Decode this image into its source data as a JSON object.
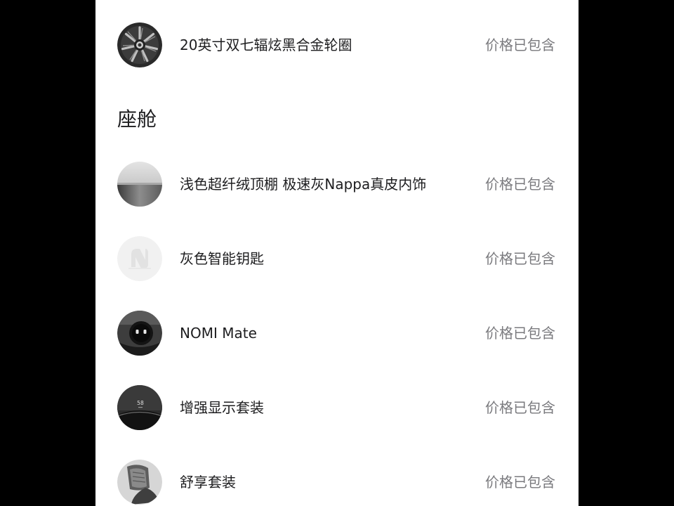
{
  "sections": [
    {
      "title": "",
      "items": [
        {
          "icon": "wheel-icon",
          "name": "20英寸双七辐炫黑合金轮圈",
          "price": "价格已包含"
        }
      ]
    },
    {
      "title": "座舱",
      "items": [
        {
          "icon": "interior-swatch-icon",
          "name": "浅色超纤绒顶棚 极速灰Nappa真皮内饰",
          "price": "价格已包含"
        },
        {
          "icon": "smart-key-icon",
          "name": "灰色智能钥匙",
          "price": "价格已包含"
        },
        {
          "icon": "nomi-mate-icon",
          "name": "NOMI Mate",
          "price": "价格已包含"
        },
        {
          "icon": "hud-display-icon",
          "name": "增强显示套装",
          "price": "价格已包含"
        },
        {
          "icon": "comfort-seat-icon",
          "name": "舒享套装",
          "price": "价格已包含"
        }
      ]
    }
  ]
}
